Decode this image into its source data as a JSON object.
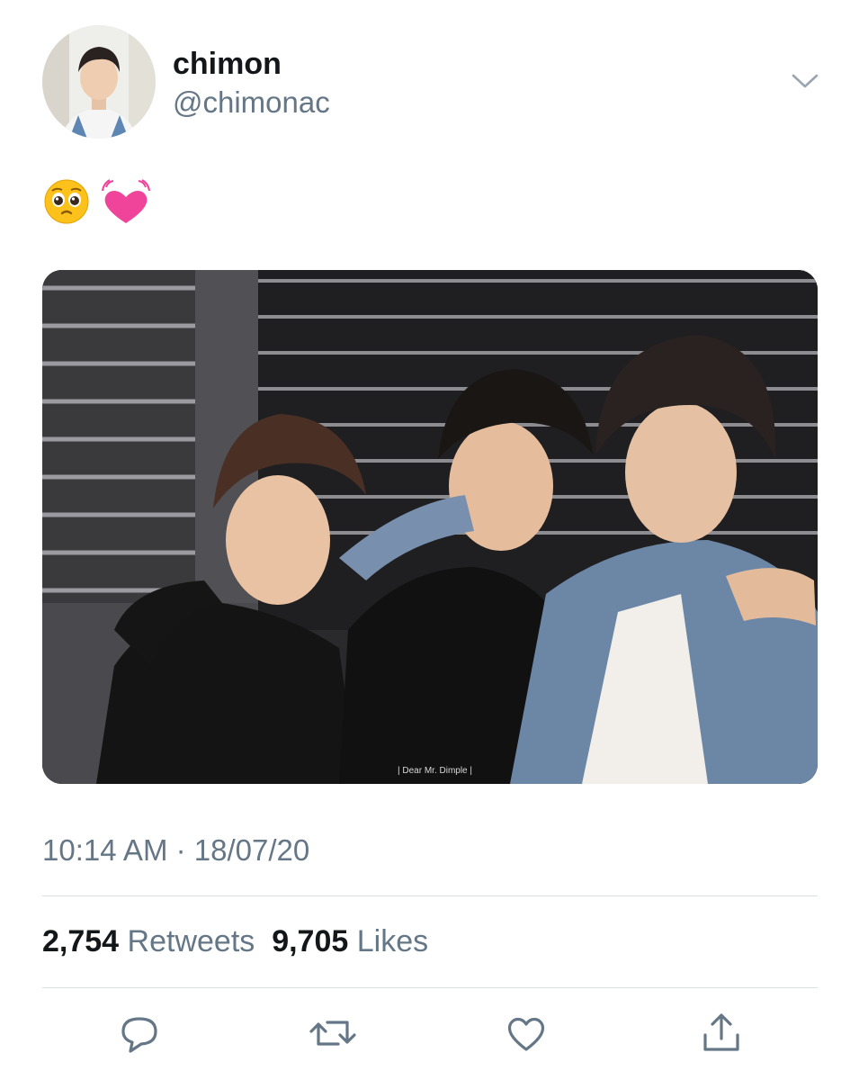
{
  "tweet": {
    "display_name": "chimon",
    "handle": "@chimonac",
    "emojis": [
      "pleading-face-emoji",
      "beating-heart-emoji"
    ],
    "media_watermark": "| Dear Mr. Dimple |",
    "timestamp": "10:14 AM · 18/07/20"
  },
  "stats": {
    "retweets_count": "2,754",
    "retweets_label": "Retweets",
    "likes_count": "9,705",
    "likes_label": "Likes"
  },
  "actions": [
    "reply-icon",
    "retweet-icon",
    "like-icon",
    "share-icon"
  ],
  "colors": {
    "text_primary": "#14171a",
    "text_secondary": "#657786",
    "divider": "#dadfe3",
    "heart_pink": "#f0449b"
  }
}
